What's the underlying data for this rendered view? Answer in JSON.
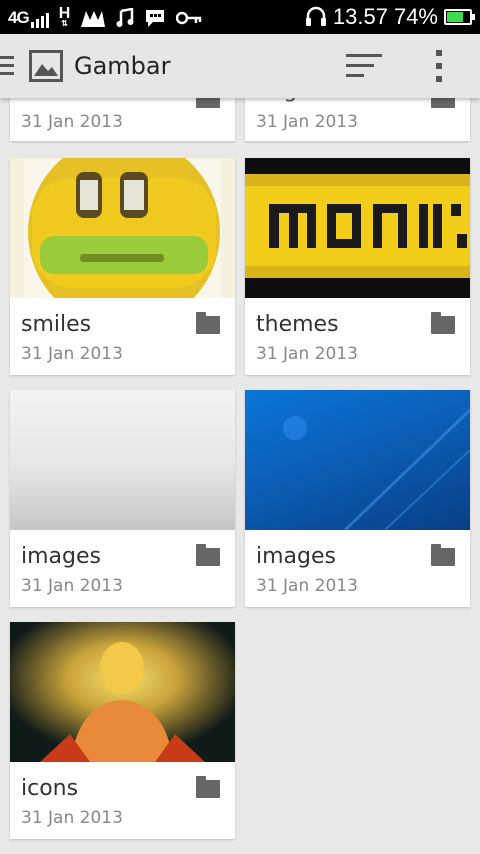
{
  "status_bar": {
    "network": "4G",
    "data_type": "H",
    "time": "13.57",
    "battery": "74%",
    "battery_level": 0.74,
    "icons": [
      "signal-icon",
      "data-h-icon",
      "notification-m-icon",
      "music-note-icon",
      "chat-icon",
      "key-icon",
      "headphones-icon",
      "battery-icon"
    ],
    "battery_color": "#3ddc4e"
  },
  "action_bar": {
    "title": "Gambar",
    "icons": [
      "menu-icon",
      "picture-icon",
      "sort-icon",
      "more-vert-icon"
    ]
  },
  "albums": [
    {
      "name": "icons",
      "date": "31 Jan 2013",
      "thumb": "partially-scrolled"
    },
    {
      "name": "nage",
      "date": "31 Jan 2013",
      "thumb": "partially-scrolled"
    },
    {
      "name": "smiles",
      "date": "31 Jan 2013",
      "thumb": "yellow-smiley"
    },
    {
      "name": "themes",
      "date": "31 Jan 2013",
      "thumb": "monster-logo"
    },
    {
      "name": "images",
      "date": "31 Jan 2013",
      "thumb": "grey-gradient"
    },
    {
      "name": "images",
      "date": "31 Jan 2013",
      "thumb": "blue-wallpaper"
    },
    {
      "name": "icons",
      "date": "31 Jan 2013",
      "thumb": "buddha-glow"
    }
  ],
  "colors": {
    "background": "#e8e8e8",
    "action_bar": "#e6e6e6",
    "card": "#ffffff",
    "folder_icon": "#666666"
  }
}
